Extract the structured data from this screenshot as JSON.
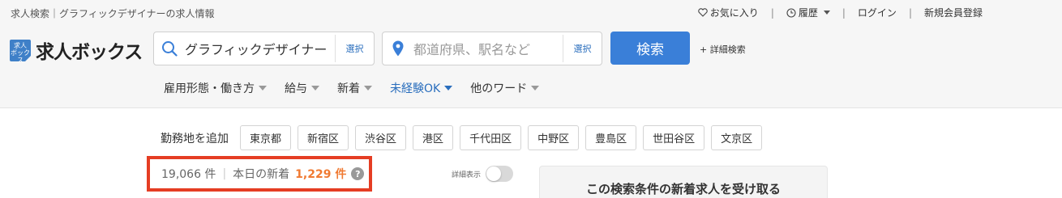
{
  "header": {
    "tagline": "求人検索｜グラフィックデザイナーの求人情報",
    "links": {
      "favorites": "お気に入り",
      "history": "履歴",
      "login": "ログイン",
      "register": "新規会員登録",
      "separator": "|"
    },
    "logo": {
      "mark": "求人ボックス",
      "text": "求人ボックス"
    }
  },
  "search": {
    "keyword": "グラフィックデザイナー",
    "keyword_select": "選択",
    "location_placeholder": "都道府県、駅名など",
    "location_select": "選択",
    "submit": "検索",
    "advanced": "+ 詳細検索"
  },
  "filters": [
    {
      "label": "雇用形態・働き方",
      "active": false
    },
    {
      "label": "給与",
      "active": false
    },
    {
      "label": "新着",
      "active": false
    },
    {
      "label": "未経験OK",
      "active": true
    },
    {
      "label": "他のワード",
      "active": false
    }
  ],
  "area": {
    "label": "勤務地を追加",
    "chips": [
      "東京都",
      "新宿区",
      "渋谷区",
      "港区",
      "千代田区",
      "中野区",
      "豊島区",
      "世田谷区",
      "文京区"
    ]
  },
  "results": {
    "total": "19,066 件",
    "new_label": "本日の新着",
    "new_count": "1,229 件",
    "help": "?"
  },
  "detail_toggle": {
    "label": "詳細表示",
    "on": false
  },
  "panel": {
    "title": "この検索条件の新着求人を受け取る"
  },
  "colors": {
    "accent": "#3a7fd8",
    "link": "#2a6ebd",
    "highlight": "#e53d23",
    "new_count": "#f07a32"
  }
}
